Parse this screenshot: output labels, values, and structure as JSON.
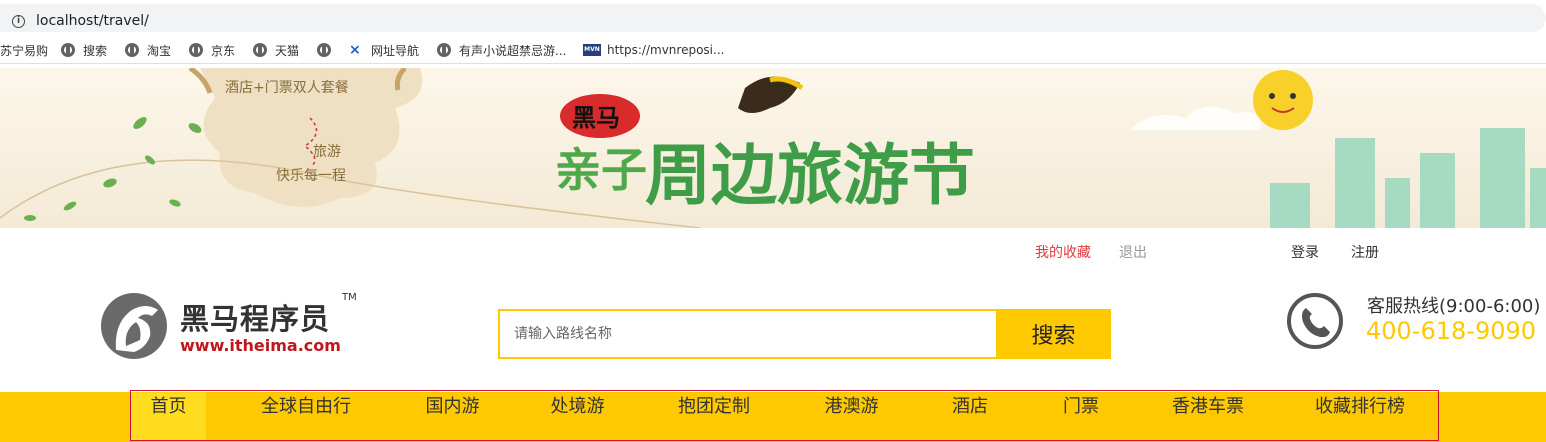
{
  "browser": {
    "url": "localhost/travel/",
    "bookmarks": [
      {
        "label": "苏宁易购",
        "icon": "none"
      },
      {
        "label": "搜索",
        "icon": "globe-icon"
      },
      {
        "label": "淘宝",
        "icon": "globe-icon"
      },
      {
        "label": "京东",
        "icon": "globe-icon"
      },
      {
        "label": "天猫",
        "icon": "globe-icon"
      },
      {
        "label": "",
        "icon": "globe-icon"
      },
      {
        "label": "网址导航",
        "icon": "x-icon"
      },
      {
        "label": "有声小说超禁忌游...",
        "icon": "globe-icon"
      },
      {
        "label": "https://mvnreposi...",
        "icon": "mvn-icon"
      }
    ]
  },
  "banner": {
    "left_text_1": "酒店+门票双人套餐",
    "left_text_2": "旅游",
    "left_text_3": "快乐每一程",
    "badge": "黑马",
    "headline_a": "亲子",
    "headline_b": "周边旅游节"
  },
  "header": {
    "favorites": "我的收藏",
    "logout": "退出",
    "login": "登录",
    "register": "注册"
  },
  "logo": {
    "name": "黑马程序员",
    "tm": "TM",
    "url": "www.itheima.com"
  },
  "search": {
    "placeholder": "请输入路线名称",
    "button": "搜索"
  },
  "hotline": {
    "label": "客服热线(9:00-6:00)",
    "number": "400-618-9090"
  },
  "nav": {
    "items": [
      "首页",
      "全球自由行",
      "国内游",
      "处境游",
      "抱团定制",
      "港澳游",
      "酒店",
      "门票",
      "香港车票",
      "收藏排行榜"
    ],
    "active": "首页"
  },
  "colors": {
    "accent": "#ffc900",
    "favorites": "#e4393c",
    "logo_url": "#c0161d"
  }
}
